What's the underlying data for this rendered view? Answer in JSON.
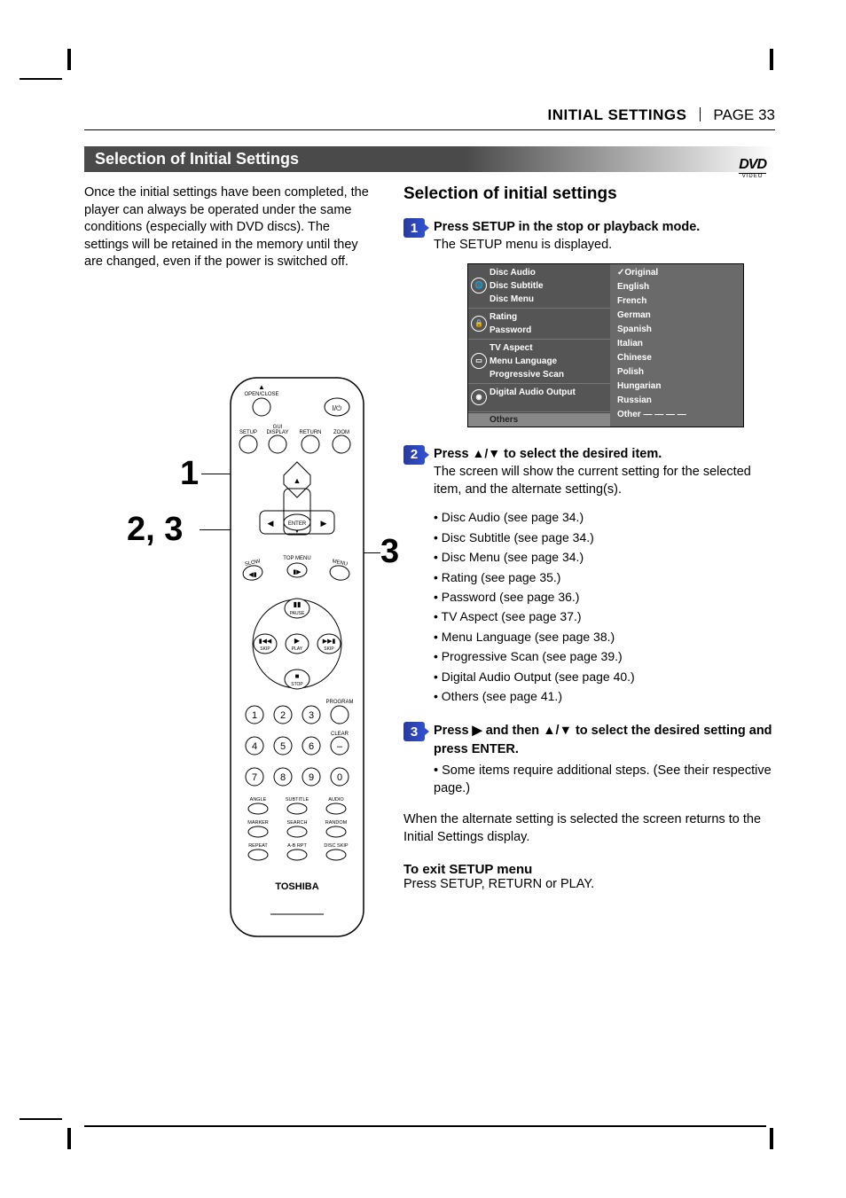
{
  "header": {
    "section_title": "INITIAL SETTINGS",
    "page_label": "PAGE 33"
  },
  "section_bar": "Selection of Initial Settings",
  "dvd_logo": {
    "top": "DVD",
    "bottom": "VIDEO"
  },
  "intro": "Once the initial settings have been completed, the player can always be operated under the same conditions (especially with DVD discs). The settings will be retained in the memory until they are changed, even if the power is switched off.",
  "remote": {
    "callout_1": "1",
    "callout_23": "2, 3",
    "callout_3": "3",
    "brand": "TOSHIBA",
    "labels": {
      "open_close": "OPEN/CLOSE",
      "setup": "SETUP",
      "gui_display": "GUI\nDISPLAY",
      "return": "RETURN",
      "zoom": "ZOOM",
      "enter": "ENTER",
      "slow": "SLOW",
      "top_menu": "TOP MENU",
      "menu": "MENU",
      "pause": "PAUSE",
      "play": "PLAY",
      "stop": "STOP",
      "skip_back": "SKIP",
      "skip_fwd": "SKIP",
      "program": "PROGRAM",
      "clear": "CLEAR",
      "angle": "ANGLE",
      "subtitle": "SUBTITLE",
      "audio": "AUDIO",
      "marker": "MARKER",
      "search": "SEARCH",
      "random": "RANDOM",
      "repeat": "REPEAT",
      "ab_rpt": "A-B RPT",
      "disc_skip": "DISC SKIP"
    }
  },
  "sub_heading": "Selection of initial settings",
  "step1": {
    "num": "1",
    "bold": "Press SETUP in the stop or playback mode.",
    "body": "The SETUP menu is displayed."
  },
  "setup_menu": {
    "left_groups": [
      {
        "icon": "globe",
        "items": [
          "Disc Audio",
          "Disc Subtitle",
          "Disc Menu"
        ]
      },
      {
        "icon": "lock",
        "items": [
          "Rating",
          "Password"
        ]
      },
      {
        "icon": "tv",
        "items": [
          "TV Aspect",
          "Menu Language",
          "Progressive Scan"
        ]
      },
      {
        "icon": "disc",
        "items": [
          "Digital Audio Output"
        ]
      }
    ],
    "left_others": "Others",
    "right": [
      "✓Original",
      "English",
      "French",
      "German",
      "Spanish",
      "Italian",
      "Chinese",
      "Polish",
      "Hungarian",
      "Russian",
      "Other  — — — —"
    ]
  },
  "step2": {
    "num": "2",
    "bold_pre": "Press ",
    "bold_post": " to select the desired item.",
    "body": "The screen will show the current setting for the selected item, and the alternate setting(s).",
    "bullets": [
      "Disc Audio (see page 34.)",
      "Disc Subtitle (see page 34.)",
      "Disc Menu (see page 34.)",
      "Rating (see page 35.)",
      "Password (see page 36.)",
      "TV Aspect (see page 37.)",
      "Menu Language (see page 38.)",
      "Progressive Scan (see page 39.)",
      "Digital Audio Output (see page 40.)",
      "Others (see page 41.)"
    ]
  },
  "step3": {
    "num": "3",
    "bold_pre": "Press ",
    "bold_mid": " and then ",
    "bold_post": " to select the desired setting and press ENTER.",
    "bullet": "Some items require additional steps. (See their respective page.)"
  },
  "closing": "When the alternate setting is selected the screen returns to the Initial Settings display.",
  "exit_heading": "To exit SETUP menu",
  "exit_body": "Press SETUP, RETURN or PLAY."
}
